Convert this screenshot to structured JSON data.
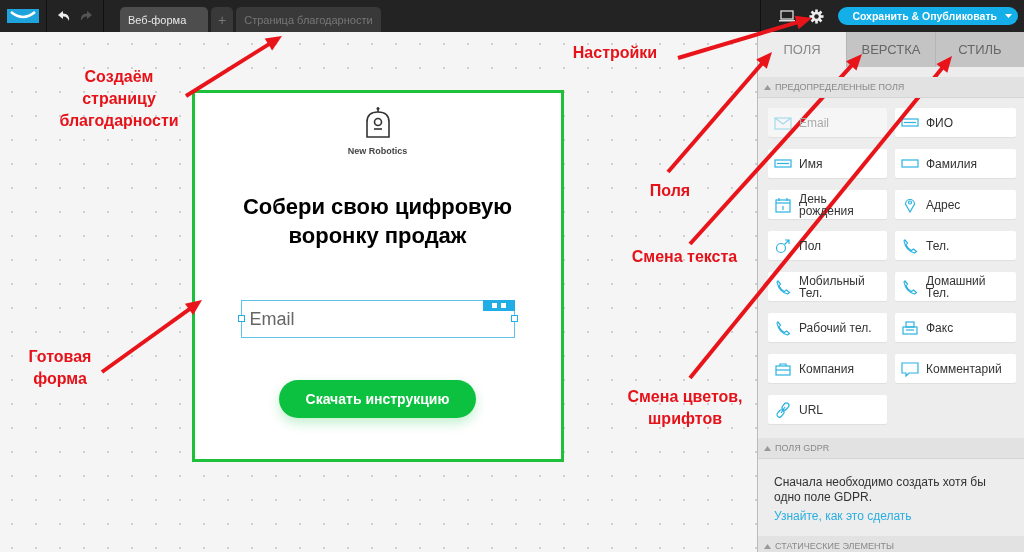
{
  "topbar": {
    "tabs": [
      {
        "label": "Веб-форма",
        "selected": true
      },
      {
        "label": "+",
        "selected": false
      },
      {
        "label": "Страница благодарности",
        "selected": false
      }
    ],
    "publish_button": "Сохранить & Опубликовать"
  },
  "form": {
    "brand": "New Robotics",
    "heading": "Собери свою цифровую воронку продаж",
    "email_placeholder": "Email",
    "button": "Скачать инструкцию"
  },
  "panel": {
    "tabs": [
      {
        "label": "ПОЛЯ",
        "selected": true
      },
      {
        "label": "ВЕРСТКА",
        "selected": false
      },
      {
        "label": "СТИЛЬ",
        "selected": false
      }
    ],
    "predefined": {
      "title": "ПРЕДОПРЕДЕЛЕННЫЕ ПОЛЯ",
      "fields": [
        {
          "label": "Email",
          "kind": "email",
          "disabled": true
        },
        {
          "label": "ФИО",
          "kind": "name",
          "disabled": false
        },
        {
          "label": "Имя",
          "kind": "name",
          "disabled": false
        },
        {
          "label": "Фамилия",
          "kind": "surname",
          "disabled": false
        },
        {
          "label": "День рождения",
          "kind": "date",
          "disabled": false
        },
        {
          "label": "Адрес",
          "kind": "pin",
          "disabled": false
        },
        {
          "label": "Пол",
          "kind": "gender",
          "disabled": false
        },
        {
          "label": "Тел.",
          "kind": "phone",
          "disabled": false
        },
        {
          "label": "Мобильный Тел.",
          "kind": "phone",
          "disabled": false
        },
        {
          "label": "Домашний Тел.",
          "kind": "phone",
          "disabled": false
        },
        {
          "label": "Рабочий тел.",
          "kind": "phone",
          "disabled": false
        },
        {
          "label": "Факс",
          "kind": "fax",
          "disabled": false
        },
        {
          "label": "Компания",
          "kind": "company",
          "disabled": false
        },
        {
          "label": "Комментарий",
          "kind": "comment",
          "disabled": false
        },
        {
          "label": "URL",
          "kind": "url",
          "disabled": false
        }
      ]
    },
    "gdpr": {
      "title": "ПОЛЯ GDPR",
      "text": "Сначала необходимо создать хотя бы одно поле GDPR.",
      "link": "Узнайте, как это сделать"
    },
    "static": {
      "title": "СТАТИЧЕСКИЕ ЭЛЕМЕНТЫ"
    }
  },
  "annotations": [
    {
      "text": "Создаём страницу благодарности"
    },
    {
      "text": "Настройки"
    },
    {
      "text": "Поля"
    },
    {
      "text": "Смена текста"
    },
    {
      "text": "Готовая форма"
    },
    {
      "text": "Смена цветов, шрифтов"
    }
  ]
}
